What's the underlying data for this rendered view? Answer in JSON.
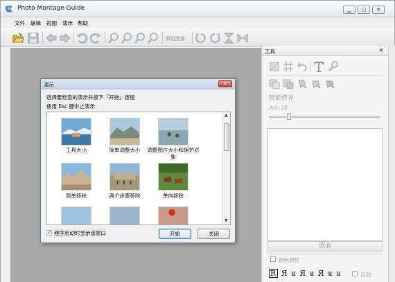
{
  "window": {
    "title": "Photo Montage Guide",
    "controls": [
      "▁",
      "▢",
      "✕"
    ]
  },
  "menu": [
    "文件",
    "编辑",
    "视图",
    "演示",
    "帮助"
  ],
  "toolbar": {
    "text_button": "原始图像"
  },
  "tools_panel": {
    "title": "工具",
    "close": "×",
    "section_label": "智能修补",
    "size_label": "大小 25",
    "cancel_label": "取消",
    "color_adjust_label": "颜色调整",
    "auto_label": "自动",
    "glyphs": [
      "R",
      "Я",
      "ᴚ",
      "Я",
      "ᴚ",
      "Я",
      "ᴚ",
      "ᴚ"
    ]
  },
  "dialog": {
    "title": "演示",
    "close": "✕",
    "instruction": "选择要检查的演示并按下「开始」按钮",
    "esc_hint": "使用 Esc 键中止演示",
    "items": [
      {
        "caption": "工具大小"
      },
      {
        "caption": "简单调整大小"
      },
      {
        "caption": "调整图片大小和保护对象"
      },
      {
        "caption": "简单移除"
      },
      {
        "caption": "两个步骤移除"
      },
      {
        "caption": "单向移除"
      }
    ],
    "startup_checkbox": "程序启动时显示该窗口",
    "startup_checked": true,
    "start_button": "开始",
    "close_button": "关闭"
  },
  "colors": {
    "workspace": "#aaaaaa",
    "dialog_title": "#c5d6ea",
    "close_red": "#c8442c"
  }
}
